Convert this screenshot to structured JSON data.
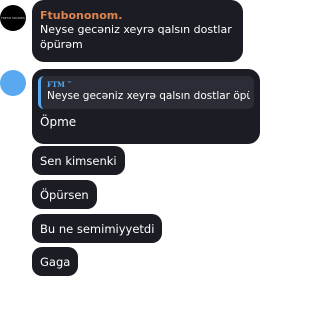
{
  "messages": [
    {
      "avatar_text": "FRESH SOUNDS",
      "sender": "Ftubononom.",
      "text": "Neyse gecəniz xeyrə qalsın dostlar öpürəm"
    },
    {
      "reply": {
        "name": "FTM",
        "name_sup": "™",
        "text": "Neyse gecəniz xeyrə qalsın dostlar öpürə..."
      },
      "text": "Öpme"
    },
    {
      "text": "Sen kimsenki"
    },
    {
      "text": "Öpürsen"
    },
    {
      "text": "Bu ne semimiyyetdi"
    },
    {
      "text": "Gaga"
    }
  ]
}
